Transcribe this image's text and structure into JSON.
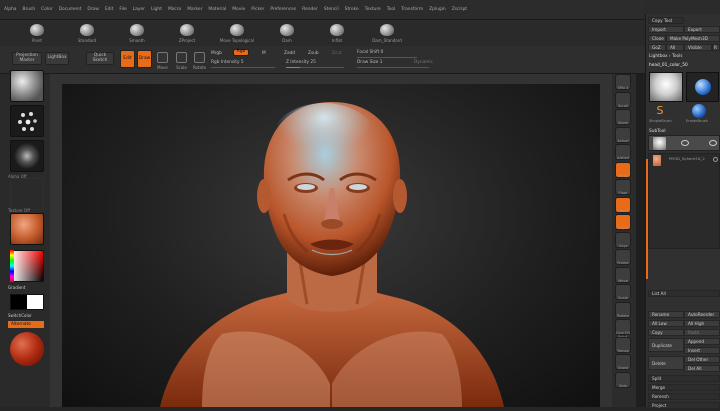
{
  "menu": [
    "Alpha",
    "Brush",
    "Color",
    "Document",
    "Draw",
    "Edit",
    "File",
    "Layer",
    "Light",
    "Macro",
    "Marker",
    "Material",
    "Movie",
    "Picker",
    "Preferences",
    "Render",
    "Stencil",
    "Stroke",
    "Texture",
    "Tool",
    "Transform",
    "Zplugin",
    "Zscript"
  ],
  "brushes": [
    {
      "label": "Paint"
    },
    {
      "label": "Standard"
    },
    {
      "label": "Smooth"
    },
    {
      "label": "ZProject"
    },
    {
      "label": "Move Topological"
    },
    {
      "label": "Dam"
    },
    {
      "label": "Inflat"
    },
    {
      "label": "Dam_Standard"
    }
  ],
  "toolbar": {
    "projection_master": "Projection Master",
    "lightbox": "LightBox",
    "quick_sketch": "Quick Sketch",
    "edit": "Edit",
    "draw": "Draw",
    "move": "Move",
    "scale": "Scale",
    "rotate": "Rotate",
    "mrgb": "Mrgb",
    "rgb": "Rgb",
    "m": "M",
    "rgb_intensity": "Rgb Intensity 5",
    "zadd": "Zadd",
    "zsub": "Zsub",
    "zcut": "Zcut",
    "z_intensity": "Z Intensity 25",
    "focal_shift": "Focal Shift 0",
    "draw_size": "Draw Size 1",
    "dynamic": "Dynamic"
  },
  "left_panel": {
    "alpha_off": "Alpha Off",
    "texture_off": "Texture Off",
    "gradient": "Gradient",
    "switch_color": "SwitchColor",
    "alternate": "Alternate"
  },
  "right_strip": [
    "SPix 3",
    "Scroll",
    "Zoom",
    "Actual",
    "AAHalf",
    "Persp",
    "Floor",
    "Local",
    "LSym",
    "Gxyz",
    "Frame",
    "Move",
    "Scale",
    "Rotate",
    "Line Fill PolyF",
    "Transp",
    "Ghost",
    "Solo"
  ],
  "panel": {
    "copy_tool": "Copy Tool",
    "import": "Import",
    "export": "Export",
    "clone": "Clone",
    "make_polymesh": "Make PolyMesh3D",
    "goz": "GoZ",
    "all": "All",
    "visible": "Visible",
    "r": "R",
    "lightbox_tools": "Lightbox › Tools",
    "current_tool": "head_01_color_50",
    "tool_thumbs": [
      "head_01_color_50",
      "PolySphere",
      "SimpleBrush",
      "EraserBrush"
    ],
    "subtool": "SubTool",
    "subtool_item": "PM3D_Sphere3D_2",
    "list_all": "List All",
    "rename": "Rename",
    "autoreorder": "AutoReorder",
    "all_low": "All Low",
    "all_high": "All High",
    "copy": "Copy",
    "paste": "Paste",
    "duplicate": "Duplicate",
    "append": "Append",
    "insert": "Insert",
    "delete": "Delete",
    "del_other": "Del Other",
    "del_all": "Del All",
    "split": "Split",
    "merge": "Merge",
    "remesh": "Remesh",
    "project": "Project"
  },
  "colors": {
    "accent": "#e86b1a",
    "model": "#c9795a",
    "highlight": "#9fc6d8"
  }
}
